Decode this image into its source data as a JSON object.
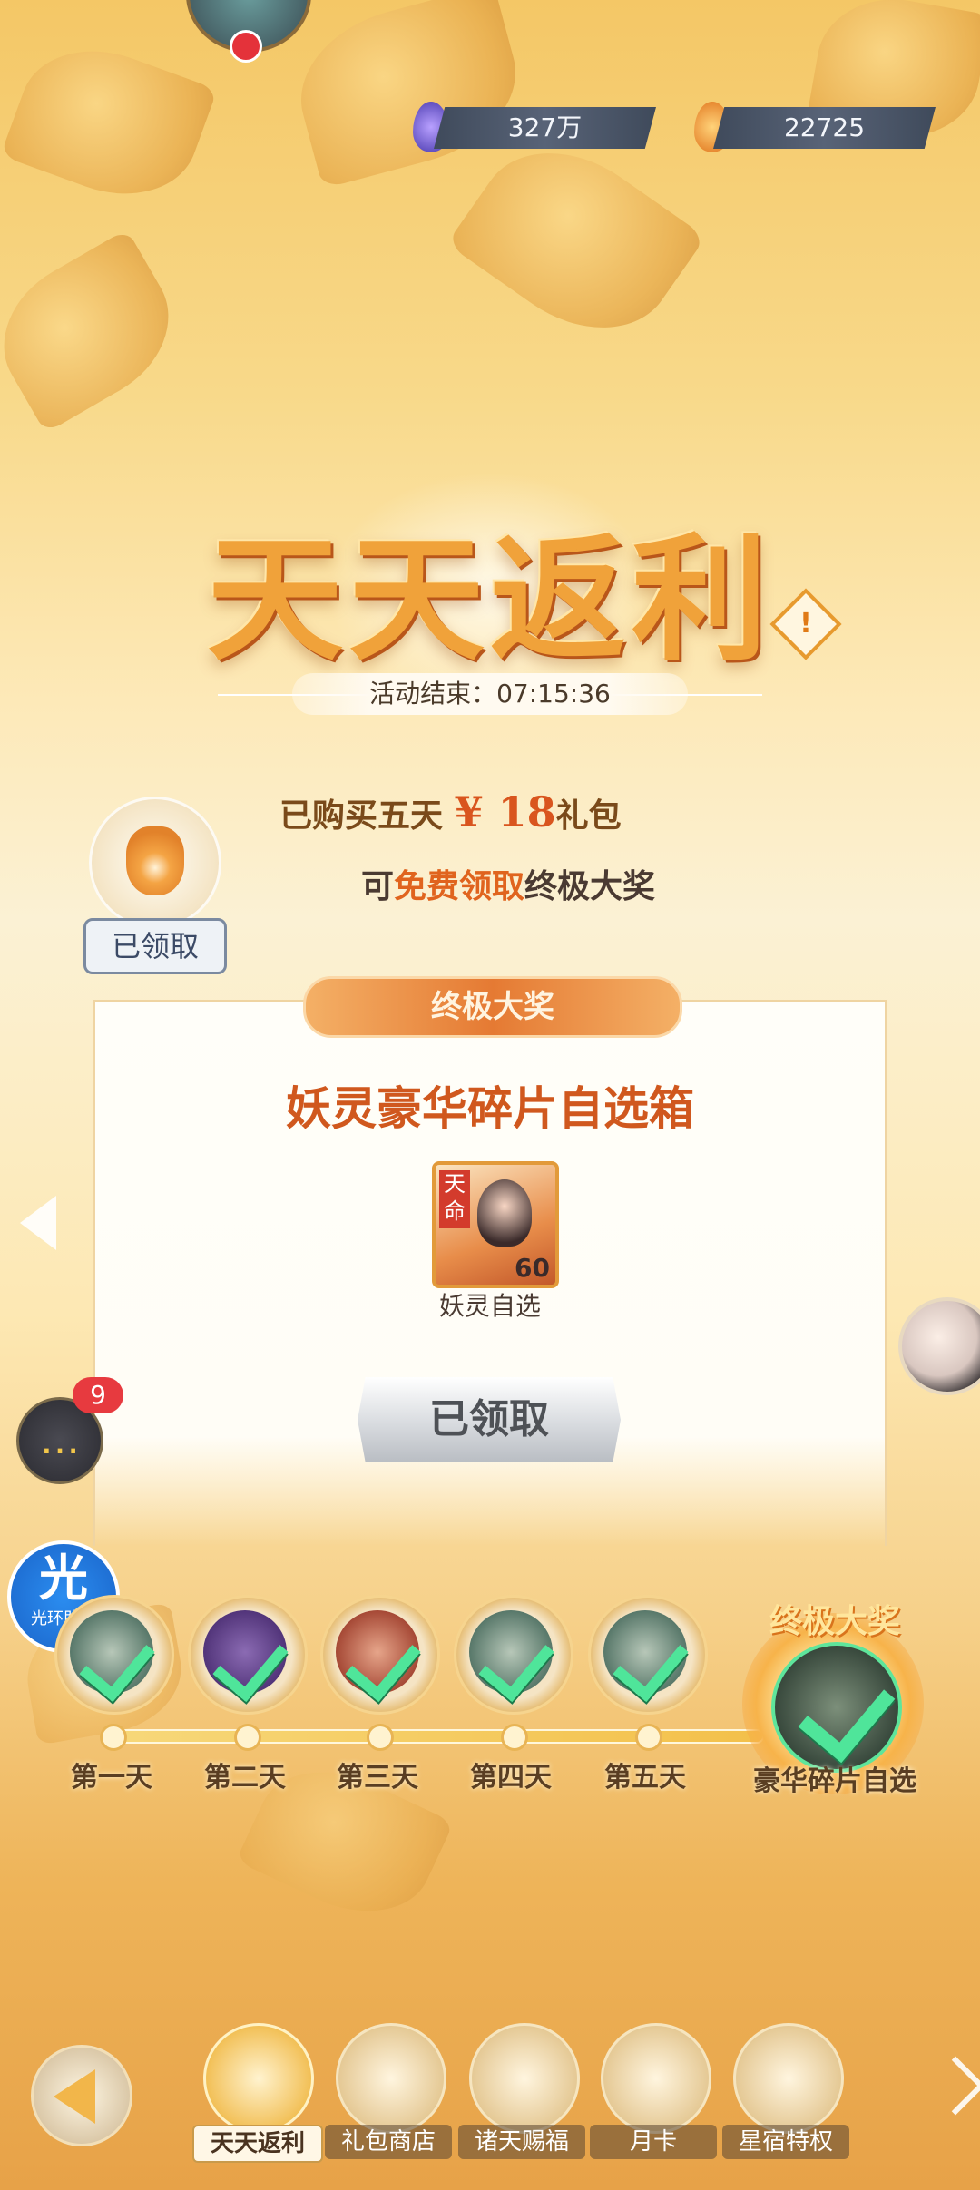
{
  "currency": {
    "gems": "327万",
    "coins": "22725"
  },
  "event": {
    "title": "天天返利",
    "timer": "活动结束：07:15:36"
  },
  "notice": {
    "line1_prefix": "已购买五天",
    "line1_price": "¥ 18",
    "line1_suffix": "礼包",
    "line2_prefix": "可",
    "line2_highlight": "免费领取",
    "line2_suffix": "终极大奖",
    "bag_status": "已领取"
  },
  "prize": {
    "header": "终极大奖",
    "name": "妖灵豪华碎片自选箱",
    "item_badge": "天命",
    "item_qty": "60",
    "item_label": "妖灵自选",
    "button": "已领取"
  },
  "progress": {
    "days": [
      {
        "label": "第一天",
        "claimed": true
      },
      {
        "label": "第二天",
        "claimed": true
      },
      {
        "label": "第三天",
        "claimed": true
      },
      {
        "label": "第四天",
        "claimed": true
      },
      {
        "label": "第五天",
        "claimed": true
      }
    ],
    "final": {
      "title": "终极大奖",
      "label": "豪华碎片自选",
      "claimed": true
    }
  },
  "side": {
    "chat_badge": "9",
    "assistant_big": "光",
    "assistant_small": "光环助手"
  },
  "nav": {
    "items": [
      {
        "label": "天天返利",
        "active": true
      },
      {
        "label": "礼包商店",
        "active": false
      },
      {
        "label": "诸天赐福",
        "active": false
      },
      {
        "label": "月卡",
        "active": false
      },
      {
        "label": "星宿特权",
        "active": false
      }
    ]
  }
}
